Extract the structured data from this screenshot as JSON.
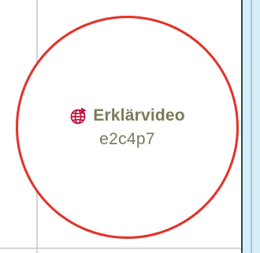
{
  "badge": {
    "icon": "globe-cursor-icon",
    "title": "Erklärvideo",
    "code": "e2c4p7"
  },
  "colors": {
    "ring": "#e3322b",
    "text": "#7a7a59",
    "icon": "#c0103a",
    "panel": "#d6eef8"
  }
}
